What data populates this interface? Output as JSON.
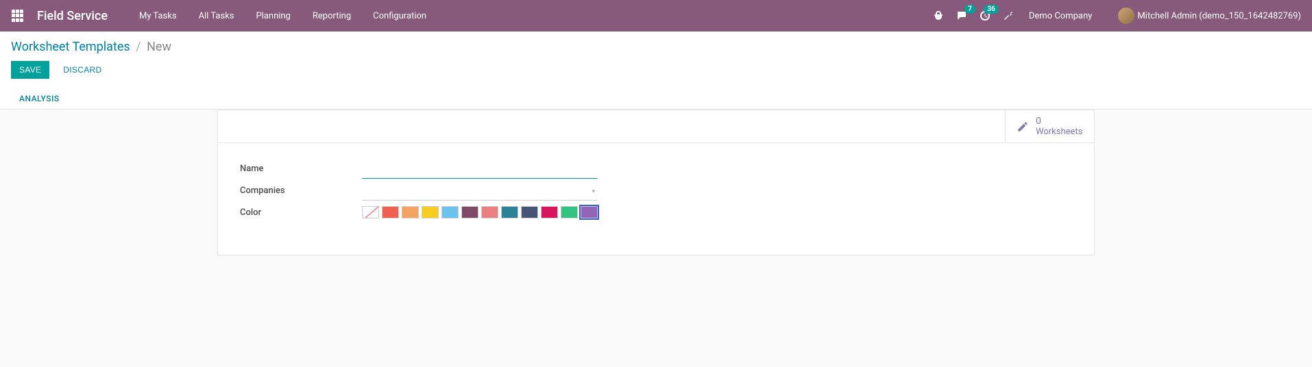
{
  "nav": {
    "app_title": "Field Service",
    "menu": [
      "My Tasks",
      "All Tasks",
      "Planning",
      "Reporting",
      "Configuration"
    ],
    "messaging_badge": "7",
    "activities_badge": "36",
    "company": "Demo Company",
    "user_name": "Mitchell Admin (demo_150_1642482769)"
  },
  "breadcrumb": {
    "parent": "Worksheet Templates",
    "current": "New"
  },
  "buttons": {
    "save": "Save",
    "discard": "Discard"
  },
  "tabs": {
    "analysis": "Analysis"
  },
  "stat": {
    "worksheets_count": "0",
    "worksheets_label": "Worksheets"
  },
  "form": {
    "name_label": "Name",
    "name_value": "",
    "companies_label": "Companies",
    "companies_value": "",
    "color_label": "Color",
    "colors": [
      {
        "hex": "none"
      },
      {
        "hex": "#F06050"
      },
      {
        "hex": "#F4A460"
      },
      {
        "hex": "#F7CD1F"
      },
      {
        "hex": "#6CC1ED"
      },
      {
        "hex": "#814968"
      },
      {
        "hex": "#EB7E7F"
      },
      {
        "hex": "#2C8397"
      },
      {
        "hex": "#475577"
      },
      {
        "hex": "#D6145F"
      },
      {
        "hex": "#30C381"
      },
      {
        "hex": "#9365B8"
      }
    ],
    "color_selected_index": 11
  }
}
